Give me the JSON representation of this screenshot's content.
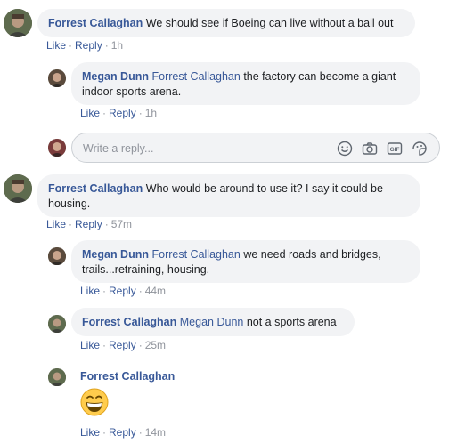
{
  "actions": {
    "like": "Like",
    "reply": "Reply",
    "dot": "·"
  },
  "comments": [
    {
      "author": "Forrest Callaghan",
      "mention": "",
      "text": "We should see if Boeing can live without a bail out",
      "time": "1h"
    },
    {
      "author": "Megan Dunn",
      "mention": "Forrest Callaghan",
      "text_line1": "the factory can become a giant",
      "text_line2": "indoor sports arena.",
      "time": "1h"
    },
    {
      "author": "Forrest Callaghan",
      "mention": "",
      "text_line1": "Who would be around to use it? I say it could be",
      "text_line2": "housing.",
      "time": "57m"
    },
    {
      "author": "Megan Dunn",
      "mention": "Forrest Callaghan",
      "text_line1": "we need roads and bridges,",
      "text_line2": "trails...retraining, housing.",
      "time": "44m"
    },
    {
      "author": "Forrest Callaghan",
      "mention": "Megan Dunn",
      "text": "not a sports arena",
      "time": "25m"
    },
    {
      "author": "Forrest Callaghan",
      "emoji": "grinning-face-emoji",
      "time": "14m"
    }
  ],
  "reply_box": {
    "placeholder": "Write a reply...",
    "value": ""
  },
  "icons": [
    "smiley-icon",
    "camera-icon",
    "gif-icon",
    "sticker-icon"
  ],
  "colors": {
    "name": "#385898",
    "bubble": "#f2f3f5",
    "muted": "#90949c"
  }
}
